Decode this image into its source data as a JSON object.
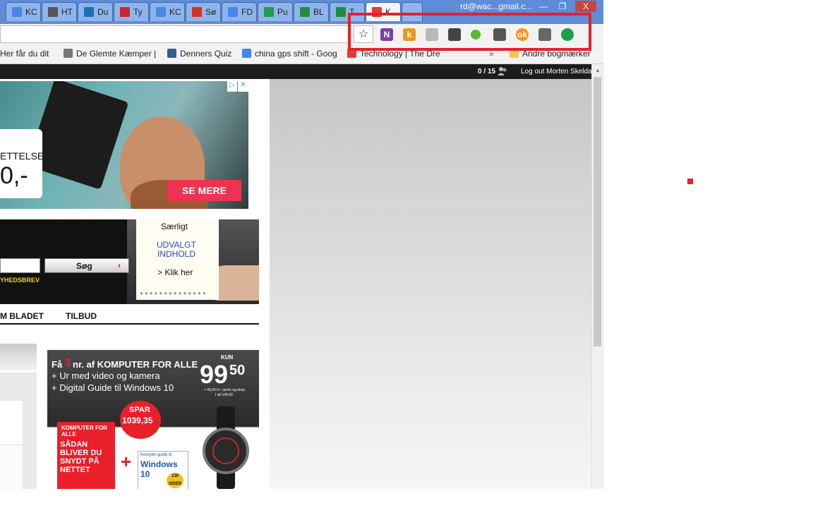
{
  "browser": {
    "tabs": [
      {
        "label": "KC",
        "color": "#4a86e8"
      },
      {
        "label": "HT",
        "color": "#555555"
      },
      {
        "label": "Du",
        "color": "#1d6fb8"
      },
      {
        "label": "Ty",
        "color": "#c62828"
      },
      {
        "label": "KC",
        "color": "#4a86e8"
      },
      {
        "label": "Sø",
        "color": "#d93025"
      },
      {
        "label": "FD",
        "color": "#4a86e8"
      },
      {
        "label": "Pu",
        "color": "#1e9e4a"
      },
      {
        "label": "BL",
        "color": "#1e8e3e"
      },
      {
        "label": "T",
        "color": "#1e8e3e"
      },
      {
        "label": "K",
        "color": "#e53935"
      }
    ],
    "account_email": "rd@wac...gmail.c...",
    "window_buttons": {
      "minimize": "—",
      "maximize": "❐",
      "close": "X"
    },
    "star_icon": "☆",
    "extensions": [
      {
        "icon": "onenote-icon",
        "glyph": "N",
        "color": "#7b3fa0"
      },
      {
        "icon": "k-extension-icon",
        "glyph": "k",
        "color": "#e89a1c"
      },
      {
        "icon": "rss-icon",
        "glyph": "",
        "color": "#b8b8b8"
      },
      {
        "icon": "evernote-icon",
        "glyph": "",
        "color": "#444444"
      },
      {
        "icon": "green-dot-icon",
        "glyph": "",
        "color": "#5cb832"
      },
      {
        "icon": "pen-icon",
        "glyph": "",
        "color": "#555555"
      },
      {
        "icon": "ok-icon",
        "glyph": "ok",
        "color": "#f7931e"
      },
      {
        "icon": "cast-icon",
        "glyph": "",
        "color": "#666666"
      },
      {
        "icon": "pushbullet-icon",
        "glyph": "",
        "color": "#1e9e4a"
      }
    ],
    "bookmarks": [
      {
        "label": "Her får du dit",
        "color": "#ffffff"
      },
      {
        "label": "De Glemte Kæmper |",
        "color": "#777777"
      },
      {
        "label": "Denners Quiz",
        "color": "#3b5998"
      },
      {
        "label": "china gps shift - Goog",
        "color": "#4285f4"
      },
      {
        "label": "Technology | The Dre",
        "color": "#e53935"
      },
      {
        "label": "Andre bogmærker",
        "color": "#f2c94c"
      }
    ],
    "bookmark_overflow": "»"
  },
  "site": {
    "counter": "0 / 15",
    "logout": "Log out Morten Skeldal",
    "ad_top": {
      "badge_line1": "ETTELSE",
      "badge_line2": "0,-",
      "cta": "SE MERE",
      "adchoices": "▷",
      "close": "✕"
    },
    "note": {
      "title": "Særligt",
      "line1": "UDVALGT",
      "line2": "INDHOLD",
      "link": "> Klik her"
    },
    "search_button": "Søg",
    "newsletter": "YHEDSBREV",
    "nav_items": [
      "M BLADET",
      "TILBUD"
    ],
    "kfa_ad": {
      "line1_pre": "Få",
      "line1_num": "3",
      "line1_post": "nr. af KOMPUTER FOR ALLE",
      "bullet1": "+ Ur med video og kamera",
      "bullet2": "+ Digital Guide til Windows 10",
      "kun": "KUN",
      "price_main": "99",
      "price_dec": "50",
      "price_note1": "+ 49,00 kr. i porto og eksp.",
      "price_note2": "I alt 149,00",
      "spar_label": "SPAR",
      "spar_amount": "1039,35",
      "mag_title": "KOMPUTER FOR ALLE",
      "mag_headline1": "SÅDAN",
      "mag_headline2": "BLIVER DU",
      "mag_headline3": "SNYDT PÅ",
      "mag_headline4": "NETTET",
      "plus": "+",
      "guide_small": "Komplet guide til",
      "guide_title": "Windows 10",
      "guide_badge": "130 SIDER"
    }
  }
}
